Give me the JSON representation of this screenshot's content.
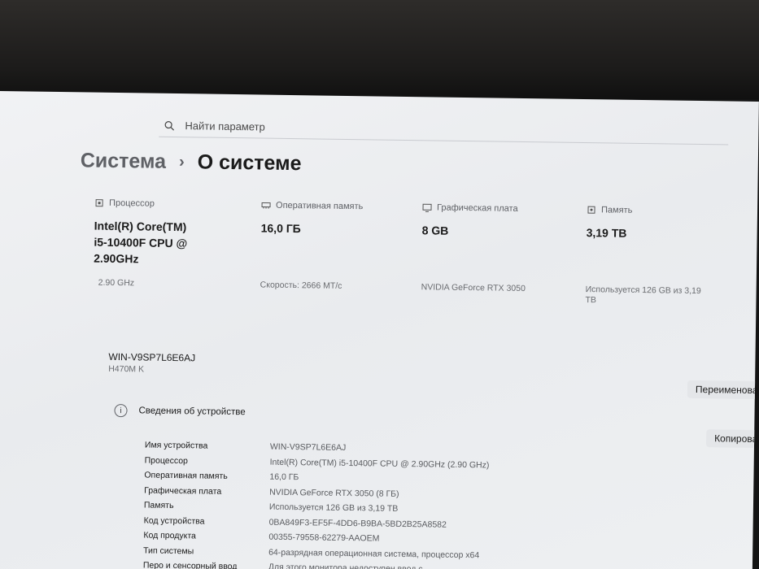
{
  "search": {
    "placeholder": "Найти параметр"
  },
  "breadcrumb": {
    "parent": "Система",
    "separator": "›",
    "current": "О системе"
  },
  "specs": [
    {
      "icon": "cpu-icon",
      "label": "Процессор",
      "value": "Intel(R) Core(TM) i5-10400F CPU @ 2.90GHz",
      "sub": "2.90 GHz"
    },
    {
      "icon": "memory-icon",
      "label": "Оперативная память",
      "value": "16,0 ГБ",
      "sub": "Скорость: 2666 МТ/с"
    },
    {
      "icon": "gpu-icon",
      "label": "Графическая плата",
      "value": "8 GB",
      "sub": "NVIDIA GeForce RTX 3050"
    },
    {
      "icon": "storage-icon",
      "label": "Память",
      "value": "3,19 TB",
      "sub": "Используется 126 GB из 3,19 TB"
    }
  ],
  "device": {
    "name": "WIN-V9SP7L6E6AJ",
    "model": "H470M K",
    "rename_label": "Переименова"
  },
  "details_section": {
    "title": "Сведения об устройстве",
    "copy_label": "Копирова",
    "rows": [
      {
        "label": "Имя устройства",
        "value": "WIN-V9SP7L6E6AJ"
      },
      {
        "label": "Процессор",
        "value": "Intel(R) Core(TM) i5-10400F CPU @ 2.90GHz (2.90 GHz)"
      },
      {
        "label": "Оперативная память",
        "value": "16,0 ГБ"
      },
      {
        "label": "Графическая плата",
        "value": "NVIDIA GeForce RTX 3050 (8 ГБ)"
      },
      {
        "label": "Память",
        "value": "Используется 126 GB из 3,19 TB"
      },
      {
        "label": "Код устройства",
        "value": "0BA849F3-EF5F-4DD6-B9BA-5BD2B25A8582"
      },
      {
        "label": "Код продукта",
        "value": "00355-79558-62279-AAOEM"
      },
      {
        "label": "Тип системы",
        "value": "64-разрядная операционная система, процессор x64"
      },
      {
        "label": "Перо и сенсорный ввод",
        "value": "Для этого монитора недоступен ввод с"
      }
    ]
  }
}
